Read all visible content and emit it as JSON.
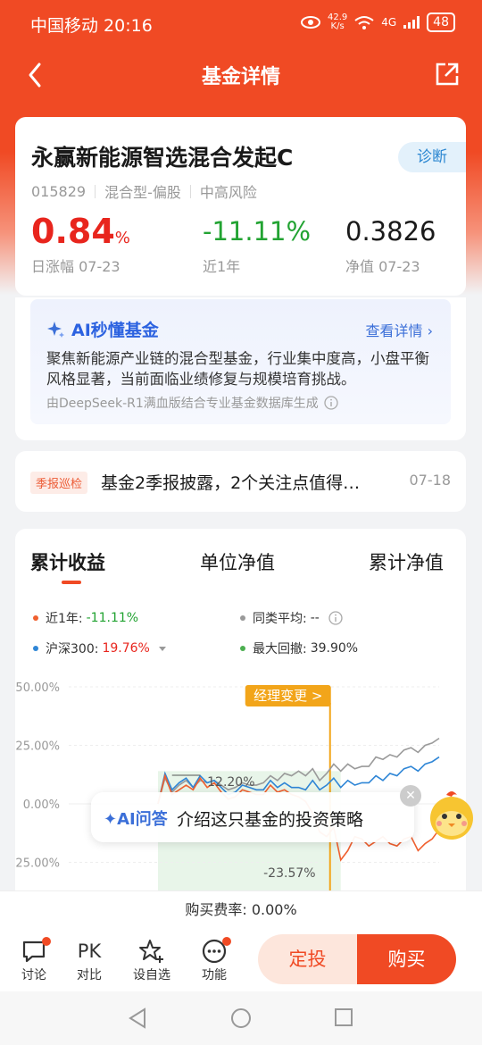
{
  "status_bar": {
    "carrier_time": "中国移动 20:16",
    "net_speed_value": "42.9",
    "net_speed_unit": "K/s",
    "signal": "4G",
    "battery": "48"
  },
  "nav": {
    "title": "基金详情"
  },
  "fund": {
    "name": "永赢新能源智选混合发起C",
    "diagnose_label": "诊断",
    "code": "015829",
    "type": "混合型-偏股",
    "risk": "中高风险",
    "daily_change_value": "0.84",
    "daily_change_unit": "%",
    "daily_change_label": "日涨幅 07-23",
    "year_change": "-11.11%",
    "year_change_label": "近1年",
    "nav_value": "0.3826",
    "nav_label": "净值 07-23"
  },
  "ai_card": {
    "title": "AI秒懂基金",
    "more": "查看详情",
    "text": "聚焦新能源产业链的混合型基金，行业集中度高，小盘平衡风格显著，当前面临业绩修复与规模培育挑战。",
    "footer": "由DeepSeek-R1满血版结合专业基金数据库生成"
  },
  "report": {
    "tag": "季报巡检",
    "title": "基金2季报披露，2个关注点值得…",
    "date": "07-18"
  },
  "chart_tabs": {
    "cumulative_return": "累计收益",
    "unit_nav": "单位净值",
    "cumulative_nav": "累计净值"
  },
  "legend": {
    "fund_label": "近1年:",
    "fund_value": "-11.11%",
    "peer_label": "同类平均:",
    "peer_value": "--",
    "index_label": "沪深300:",
    "index_value": "19.76%",
    "drawdown_label": "最大回撤:",
    "drawdown_value": "39.90%"
  },
  "chart_annotations": {
    "manager_change": "经理变更 >",
    "peak_label": "12.20%",
    "trough_label": "-23.57%"
  },
  "chart_data": {
    "type": "line",
    "yticks": [
      "50.00%",
      "25.00%",
      "0.00%",
      "-25.00%"
    ],
    "ylim": [
      -25,
      50
    ],
    "series": [
      {
        "name": "近1年",
        "color": "#f0602f",
        "values": [
          0,
          12,
          4,
          6,
          8,
          6,
          11,
          7,
          9,
          5,
          2,
          3,
          6,
          5,
          4,
          4,
          8,
          5,
          6,
          4,
          3,
          1,
          -4,
          -12,
          -14,
          -10,
          -24,
          -20,
          -14,
          -15,
          -18,
          -16,
          -14,
          -17,
          -18,
          -15,
          -14,
          -20,
          -17,
          -15,
          -11
        ]
      },
      {
        "name": "沪深300",
        "color": "#2f86d6",
        "values": [
          0,
          13,
          6,
          9,
          11,
          7,
          12,
          9,
          10,
          7,
          4,
          5,
          8,
          7,
          6,
          6,
          10,
          7,
          9,
          7,
          7,
          6,
          10,
          6,
          8,
          11,
          7,
          10,
          8,
          9,
          9,
          12,
          10,
          13,
          12,
          15,
          16,
          14,
          17,
          18,
          20
        ]
      },
      {
        "name": "同类平均",
        "color": "#9a9a9a",
        "values": [
          0,
          11,
          5,
          8,
          10,
          7,
          10,
          9,
          10,
          8,
          6,
          7,
          9,
          8,
          8,
          9,
          12,
          10,
          13,
          12,
          14,
          12,
          15,
          10,
          13,
          17,
          14,
          17,
          15,
          16,
          16,
          20,
          19,
          21,
          20,
          23,
          24,
          22,
          25,
          26,
          28
        ]
      }
    ],
    "drawdown_range_color": "#e8f5e9"
  },
  "fee": {
    "text": "购买费率: 0.00%"
  },
  "bottom": {
    "discuss": "讨论",
    "compare_icon_text": "PK",
    "compare": "对比",
    "watchlist": "设自选",
    "functions": "功能",
    "sip": "定投",
    "buy": "购买"
  },
  "ai_float": {
    "label": "AI问答",
    "text": "介绍这只基金的投资策略"
  }
}
